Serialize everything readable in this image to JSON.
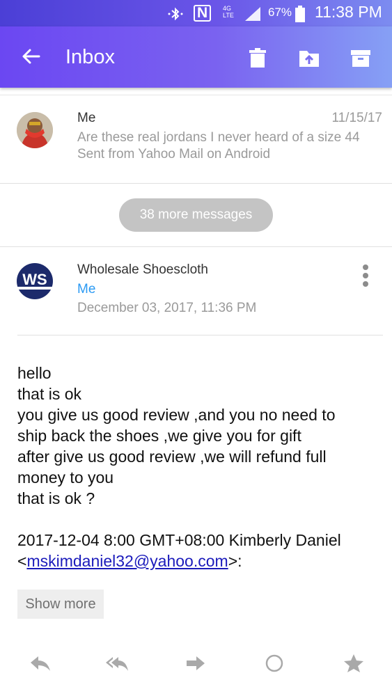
{
  "status_bar": {
    "bluetooth_icon": "bluetooth-icon",
    "nfc_label": "N",
    "network_label": "4G LTE",
    "battery": "67%",
    "time": "11:38 PM"
  },
  "toolbar": {
    "title": "Inbox",
    "icons": [
      "back-arrow-icon",
      "trash-icon",
      "move-to-folder-icon",
      "archive-icon"
    ]
  },
  "message_1": {
    "sender": "Me",
    "date": "11/15/17",
    "preview_line1": "Are these real jordans I never heard of a size 44",
    "preview_line2": "Sent from Yahoo Mail on Android"
  },
  "more_messages": "38 more messages",
  "message_2": {
    "avatar_text": "WS",
    "sender": "Wholesale Shoescloth",
    "to": "Me",
    "date": "December 03, 2017, 11:36 PM",
    "body_lines": [
      "hello",
      "that is ok",
      "you give us good review ,and you no need  to",
      "ship back the shoes ,we give you for gift",
      "after give us good review ,we will refund full",
      "money to you",
      "that is ok ?"
    ],
    "quote_header": "2017-12-04 8:00 GMT+08:00 Kimberly Daniel",
    "quote_lt": "<",
    "quote_email": "mskimdaniel32@yahoo.com",
    "quote_gt": ">:",
    "show_more": "Show more"
  },
  "bottom_bar": {
    "icons": [
      "reply-icon",
      "reply-all-icon",
      "forward-icon",
      "mark-unread-icon",
      "star-icon"
    ]
  },
  "colors": {
    "header_start": "#6b47f2",
    "header_end": "#86a0f5",
    "link_blue": "#2b9af3",
    "ws_navy": "#1c2a6b"
  }
}
